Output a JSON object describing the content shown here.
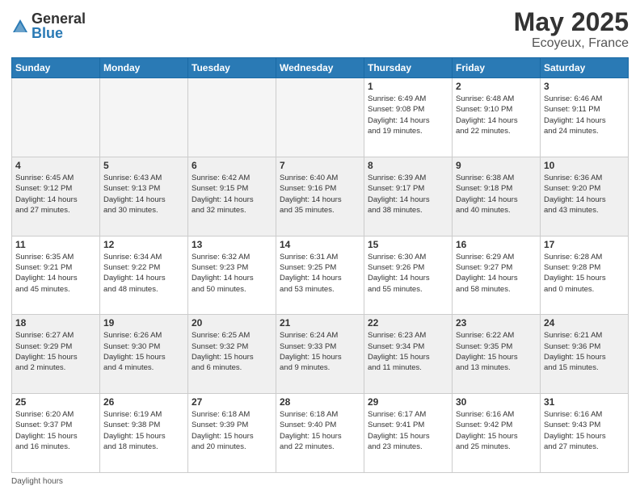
{
  "header": {
    "logo_general": "General",
    "logo_blue": "Blue",
    "month": "May 2025",
    "location": "Ecoyeux, France"
  },
  "days_of_week": [
    "Sunday",
    "Monday",
    "Tuesday",
    "Wednesday",
    "Thursday",
    "Friday",
    "Saturday"
  ],
  "weeks": [
    [
      {
        "day": "",
        "info": ""
      },
      {
        "day": "",
        "info": ""
      },
      {
        "day": "",
        "info": ""
      },
      {
        "day": "",
        "info": ""
      },
      {
        "day": "1",
        "info": "Sunrise: 6:49 AM\nSunset: 9:08 PM\nDaylight: 14 hours\nand 19 minutes."
      },
      {
        "day": "2",
        "info": "Sunrise: 6:48 AM\nSunset: 9:10 PM\nDaylight: 14 hours\nand 22 minutes."
      },
      {
        "day": "3",
        "info": "Sunrise: 6:46 AM\nSunset: 9:11 PM\nDaylight: 14 hours\nand 24 minutes."
      }
    ],
    [
      {
        "day": "4",
        "info": "Sunrise: 6:45 AM\nSunset: 9:12 PM\nDaylight: 14 hours\nand 27 minutes."
      },
      {
        "day": "5",
        "info": "Sunrise: 6:43 AM\nSunset: 9:13 PM\nDaylight: 14 hours\nand 30 minutes."
      },
      {
        "day": "6",
        "info": "Sunrise: 6:42 AM\nSunset: 9:15 PM\nDaylight: 14 hours\nand 32 minutes."
      },
      {
        "day": "7",
        "info": "Sunrise: 6:40 AM\nSunset: 9:16 PM\nDaylight: 14 hours\nand 35 minutes."
      },
      {
        "day": "8",
        "info": "Sunrise: 6:39 AM\nSunset: 9:17 PM\nDaylight: 14 hours\nand 38 minutes."
      },
      {
        "day": "9",
        "info": "Sunrise: 6:38 AM\nSunset: 9:18 PM\nDaylight: 14 hours\nand 40 minutes."
      },
      {
        "day": "10",
        "info": "Sunrise: 6:36 AM\nSunset: 9:20 PM\nDaylight: 14 hours\nand 43 minutes."
      }
    ],
    [
      {
        "day": "11",
        "info": "Sunrise: 6:35 AM\nSunset: 9:21 PM\nDaylight: 14 hours\nand 45 minutes."
      },
      {
        "day": "12",
        "info": "Sunrise: 6:34 AM\nSunset: 9:22 PM\nDaylight: 14 hours\nand 48 minutes."
      },
      {
        "day": "13",
        "info": "Sunrise: 6:32 AM\nSunset: 9:23 PM\nDaylight: 14 hours\nand 50 minutes."
      },
      {
        "day": "14",
        "info": "Sunrise: 6:31 AM\nSunset: 9:25 PM\nDaylight: 14 hours\nand 53 minutes."
      },
      {
        "day": "15",
        "info": "Sunrise: 6:30 AM\nSunset: 9:26 PM\nDaylight: 14 hours\nand 55 minutes."
      },
      {
        "day": "16",
        "info": "Sunrise: 6:29 AM\nSunset: 9:27 PM\nDaylight: 14 hours\nand 58 minutes."
      },
      {
        "day": "17",
        "info": "Sunrise: 6:28 AM\nSunset: 9:28 PM\nDaylight: 15 hours\nand 0 minutes."
      }
    ],
    [
      {
        "day": "18",
        "info": "Sunrise: 6:27 AM\nSunset: 9:29 PM\nDaylight: 15 hours\nand 2 minutes."
      },
      {
        "day": "19",
        "info": "Sunrise: 6:26 AM\nSunset: 9:30 PM\nDaylight: 15 hours\nand 4 minutes."
      },
      {
        "day": "20",
        "info": "Sunrise: 6:25 AM\nSunset: 9:32 PM\nDaylight: 15 hours\nand 6 minutes."
      },
      {
        "day": "21",
        "info": "Sunrise: 6:24 AM\nSunset: 9:33 PM\nDaylight: 15 hours\nand 9 minutes."
      },
      {
        "day": "22",
        "info": "Sunrise: 6:23 AM\nSunset: 9:34 PM\nDaylight: 15 hours\nand 11 minutes."
      },
      {
        "day": "23",
        "info": "Sunrise: 6:22 AM\nSunset: 9:35 PM\nDaylight: 15 hours\nand 13 minutes."
      },
      {
        "day": "24",
        "info": "Sunrise: 6:21 AM\nSunset: 9:36 PM\nDaylight: 15 hours\nand 15 minutes."
      }
    ],
    [
      {
        "day": "25",
        "info": "Sunrise: 6:20 AM\nSunset: 9:37 PM\nDaylight: 15 hours\nand 16 minutes."
      },
      {
        "day": "26",
        "info": "Sunrise: 6:19 AM\nSunset: 9:38 PM\nDaylight: 15 hours\nand 18 minutes."
      },
      {
        "day": "27",
        "info": "Sunrise: 6:18 AM\nSunset: 9:39 PM\nDaylight: 15 hours\nand 20 minutes."
      },
      {
        "day": "28",
        "info": "Sunrise: 6:18 AM\nSunset: 9:40 PM\nDaylight: 15 hours\nand 22 minutes."
      },
      {
        "day": "29",
        "info": "Sunrise: 6:17 AM\nSunset: 9:41 PM\nDaylight: 15 hours\nand 23 minutes."
      },
      {
        "day": "30",
        "info": "Sunrise: 6:16 AM\nSunset: 9:42 PM\nDaylight: 15 hours\nand 25 minutes."
      },
      {
        "day": "31",
        "info": "Sunrise: 6:16 AM\nSunset: 9:43 PM\nDaylight: 15 hours\nand 27 minutes."
      }
    ]
  ],
  "footer": "Daylight hours"
}
